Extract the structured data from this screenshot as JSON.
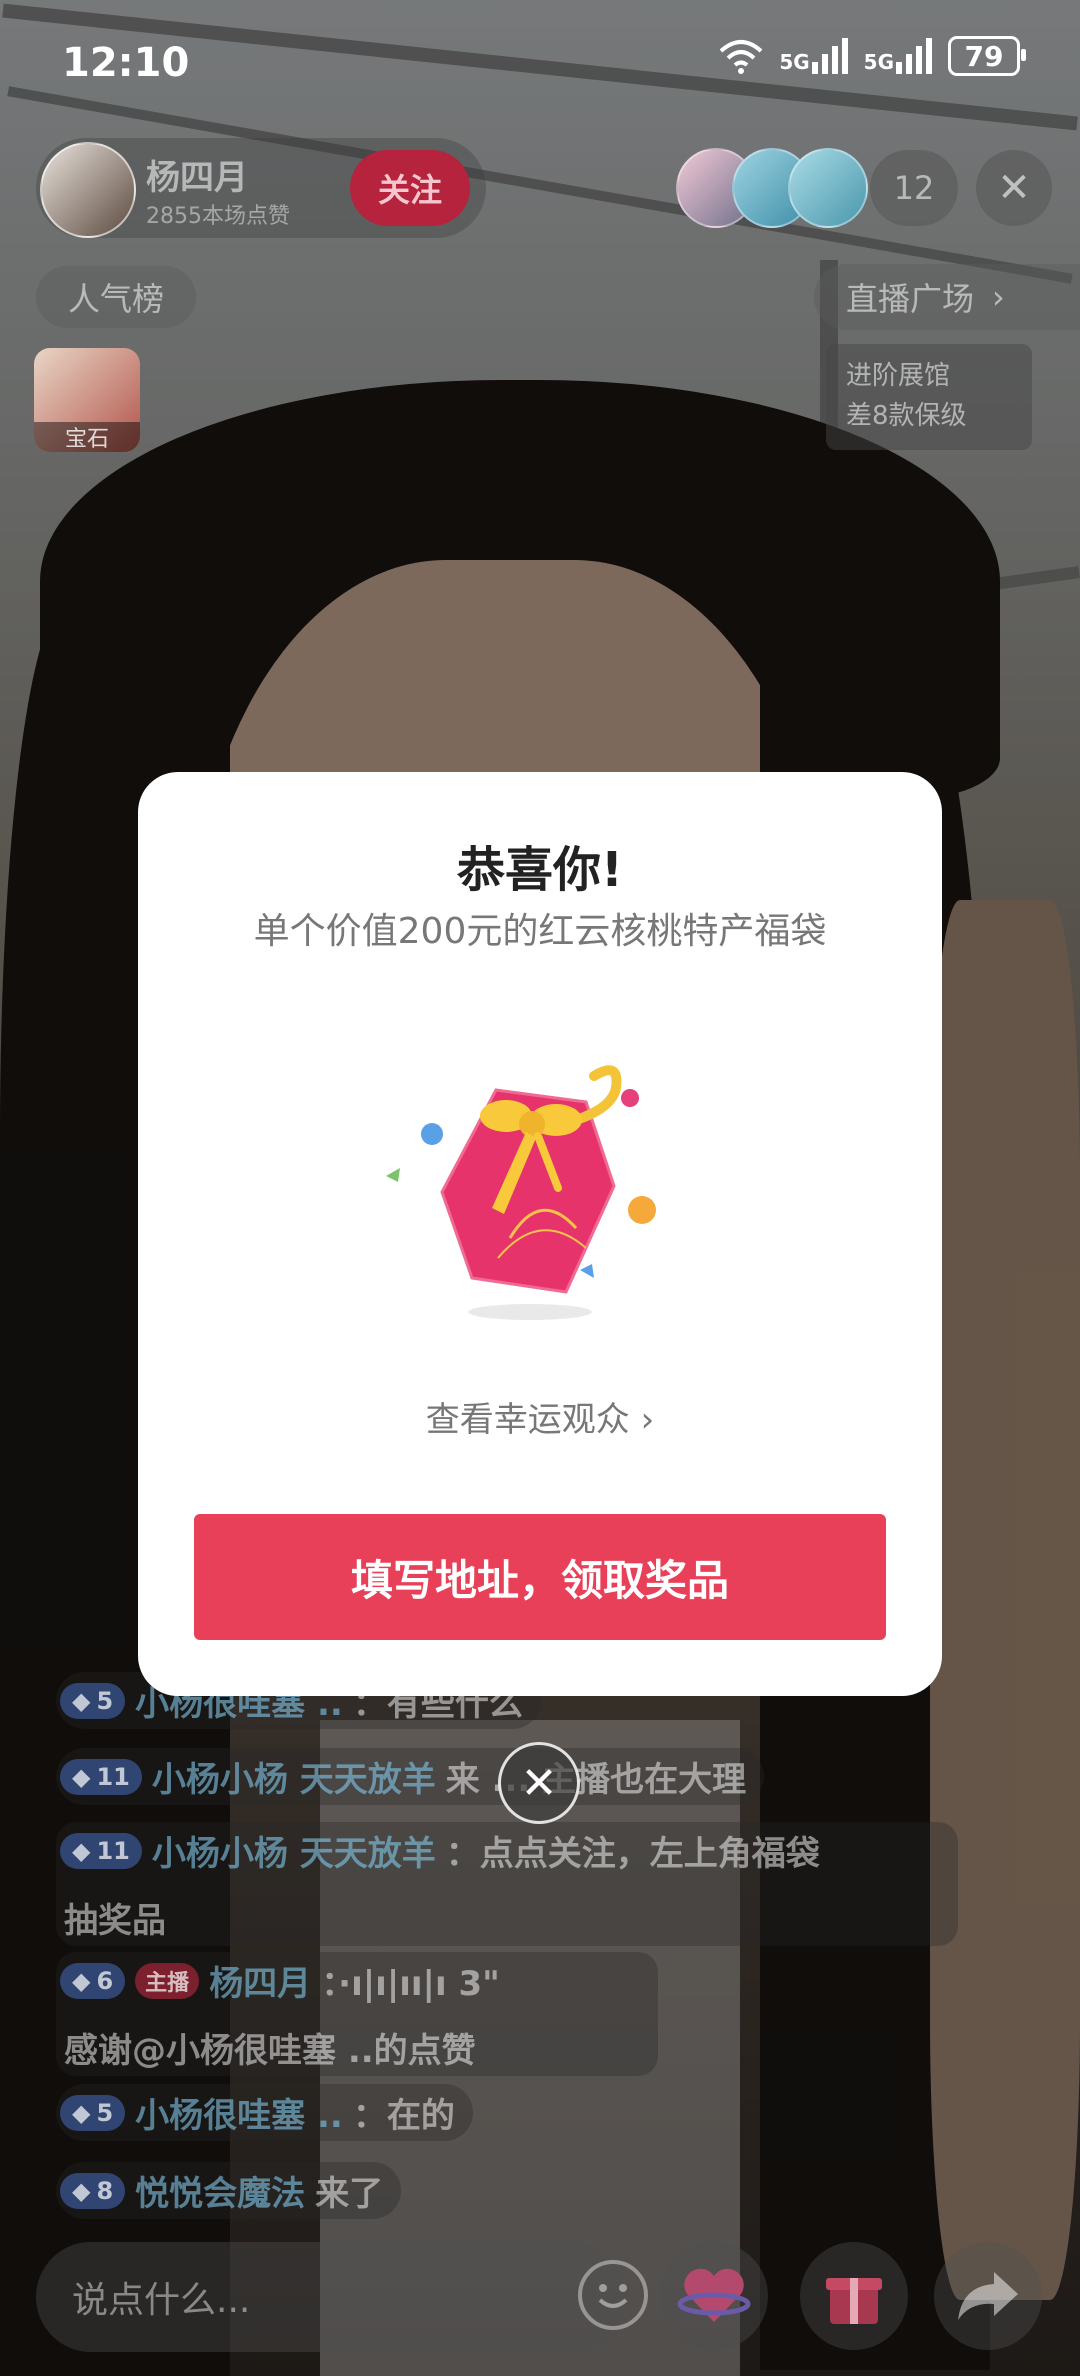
{
  "status_bar": {
    "time": "12:10",
    "network_1": "5G",
    "network_2": "5G",
    "battery": "79"
  },
  "host": {
    "name": "杨四月",
    "likes": "2855本场点赞",
    "follow_label": "关注"
  },
  "viewers": {
    "count": "12"
  },
  "top_buttons": {
    "ranking": "人气榜",
    "plaza": "直播广场",
    "gem_label": "宝石"
  },
  "exhibit": {
    "line1": "进阶展馆",
    "line2": "差8款保级"
  },
  "chat": [
    {
      "level": "5",
      "user": "小杨很哇塞 ..",
      "text": "：有些什么"
    },
    {
      "level": "11",
      "user": "小杨小杨  天天放羊",
      "text": "来 ... 主播也在大理"
    },
    {
      "level": "11",
      "user": "小杨小杨  天天放羊",
      "text": "：点点关注，左上角福袋",
      "text2": "抽奖品"
    },
    {
      "level": "6",
      "tag": "主播",
      "user": "杨四月",
      "text": "：·ı|ı|ıı|ı 3\"",
      "text2": "感谢@小杨很哇塞 ..的点赞"
    },
    {
      "level": "5",
      "user": "小杨很哇塞 ..",
      "text": "：在的"
    },
    {
      "level": "8",
      "user": "悦悦会魔法",
      "text": " 来了"
    }
  ],
  "bottom_bar": {
    "placeholder": "说点什么..."
  },
  "modal": {
    "title": "恭喜你!",
    "description": "单个价值200元的红云核桃特产福袋",
    "lucky_link": "查看幸运观众",
    "claim_button": "填写地址，领取奖品"
  },
  "colors": {
    "accent": "#e9405a",
    "follow": "#b6233d"
  }
}
